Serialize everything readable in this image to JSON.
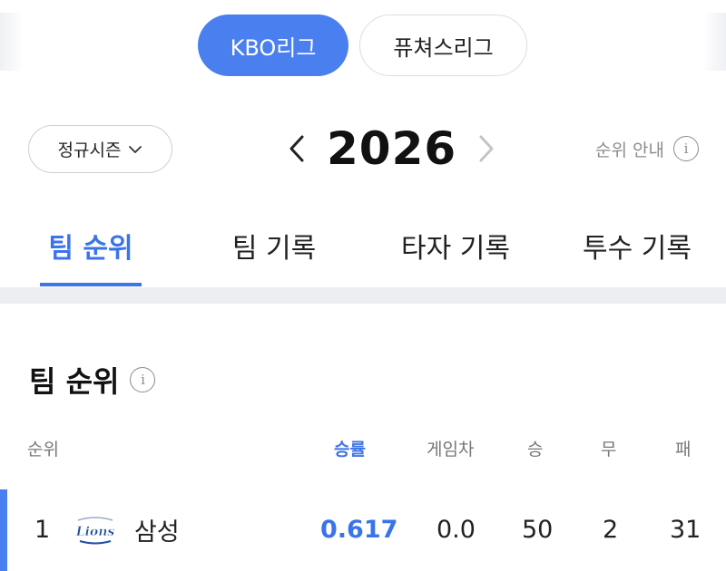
{
  "league_tabs": {
    "active": "KBO리그",
    "inactive": "퓨쳐스리그"
  },
  "season": {
    "selector_label": "정규시즌",
    "year": "2026",
    "rank_guide": "순위 안내"
  },
  "tabs": [
    {
      "label": "팀 순위",
      "active": true
    },
    {
      "label": "팀 기록",
      "active": false
    },
    {
      "label": "타자 기록",
      "active": false
    },
    {
      "label": "투수 기록",
      "active": false
    }
  ],
  "standings": {
    "title": "팀 순위",
    "columns": {
      "rank": "순위",
      "win_rate": "승률",
      "games_behind": "게임차",
      "wins": "승",
      "draws": "무",
      "losses": "패"
    },
    "rows": [
      {
        "rank": "1",
        "team": "삼성",
        "logo_text": "Lions",
        "win_rate": "0.617",
        "games_behind": "0.0",
        "wins": "50",
        "draws": "2",
        "losses": "31"
      }
    ]
  },
  "colors": {
    "accent": "#4a7ff0",
    "accent_text": "#3b74ea",
    "muted": "#8c8c8c"
  }
}
